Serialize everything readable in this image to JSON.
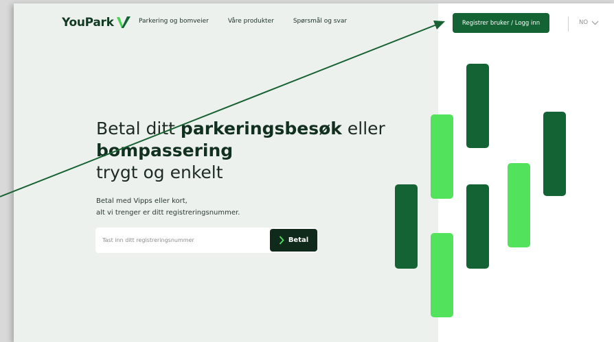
{
  "brand": {
    "name": "YouPark",
    "color": "#123a22",
    "accent": "#46d34f"
  },
  "nav": {
    "items": [
      {
        "label": "Parkering og bomveier"
      },
      {
        "label": "Våre produkter"
      },
      {
        "label": "Spørsmål og svar"
      }
    ]
  },
  "header": {
    "cta_label": "Registrer bruker / Logg inn",
    "language": "NO"
  },
  "hero": {
    "line1_part1": "Betal ditt ",
    "line1_bold": "parkeringsbesøk",
    "line1_part2": " eller",
    "line2_bold": "bompassering",
    "line3": "trygt og enkelt",
    "sub_line1": "Betal med Vipps eller kort,",
    "sub_line2": "alt vi trenger er ditt registreringsnummer."
  },
  "search": {
    "placeholder": "Tast inn ditt registreringsnummer",
    "value": "",
    "button_label": "Betal"
  },
  "colors": {
    "left_bg": "#ecf1ed",
    "dark_green": "#146335",
    "light_green": "#52e25b",
    "pay_button": "#0f2a1a",
    "annotation_arrow": "#176132"
  },
  "decorative_bars": [
    {
      "shade": "dark"
    },
    {
      "shade": "light"
    },
    {
      "shade": "light"
    },
    {
      "shade": "dark"
    },
    {
      "shade": "dark"
    },
    {
      "shade": "light"
    },
    {
      "shade": "dark"
    }
  ]
}
